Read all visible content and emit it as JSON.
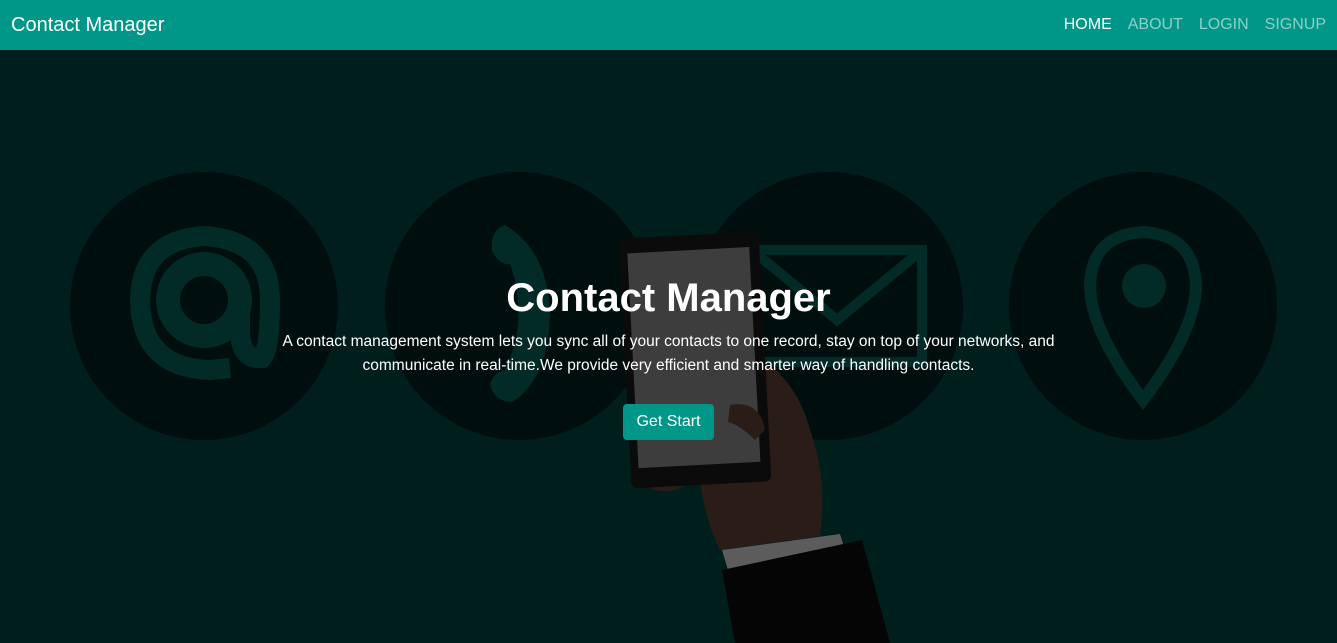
{
  "navbar": {
    "brand": "Contact Manager",
    "links": [
      {
        "label": "HOME",
        "active": true
      },
      {
        "label": "ABOUT",
        "active": false
      },
      {
        "label": "LOGIN",
        "active": false
      },
      {
        "label": "SIGNUP",
        "active": false
      }
    ]
  },
  "hero": {
    "title": "Contact Manager",
    "description": "A contact management system lets you sync all of your contacts to one record, stay on top of your networks, and communicate in real-time.We provide very efficient and smarter way of handling contacts.",
    "button_label": "Get Start",
    "background_icons": [
      "at-sign-icon",
      "phone-icon",
      "envelope-icon",
      "map-pin-icon"
    ]
  },
  "colors": {
    "primary": "#009688",
    "background": "#001e1c",
    "circle": "#000f0d",
    "icon_line": "#022a27"
  }
}
